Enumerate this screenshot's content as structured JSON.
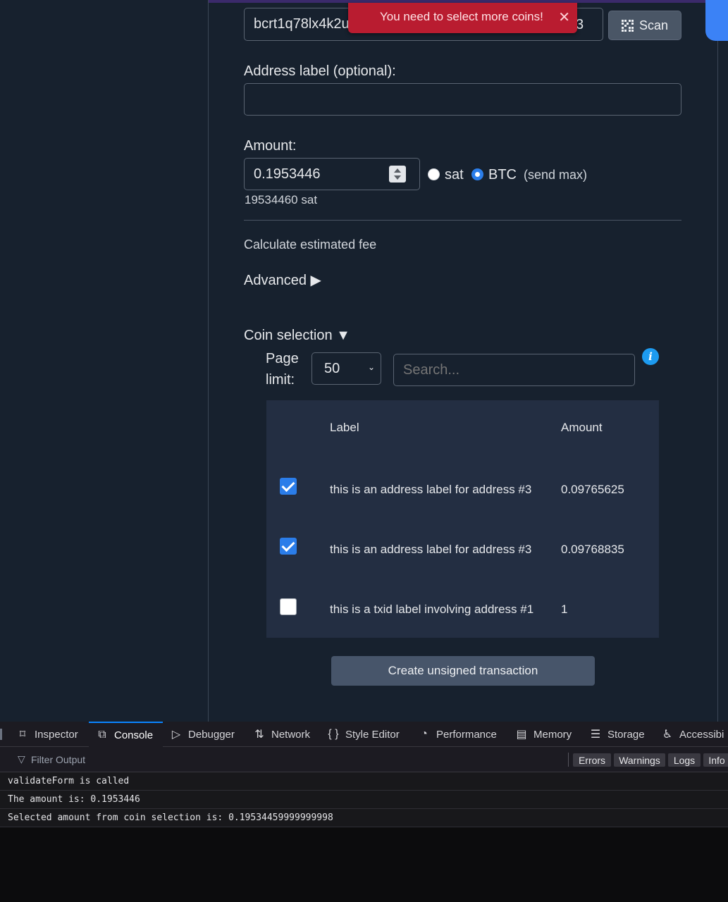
{
  "toast": {
    "message": "You need to select more coins!",
    "close": "✕"
  },
  "address": {
    "value": "bcrt1q78lx4k2u",
    "value_tail": "3"
  },
  "scan": {
    "label": "Scan"
  },
  "address_label": {
    "label": "Address label (optional):",
    "value": ""
  },
  "amount": {
    "label": "Amount:",
    "value": "0.1953446",
    "unit_sat": "sat",
    "unit_btc": "BTC",
    "selected_unit": "BTC",
    "send_max": "(send max)",
    "sat_equivalent": "19534460 sat"
  },
  "fee": {
    "label": "Calculate estimated fee"
  },
  "advanced": {
    "label": "Advanced ▶"
  },
  "coin_selection": {
    "label": "Coin selection ▼",
    "page_limit_label_1": "Page",
    "page_limit_label_2": "limit:",
    "page_limit_value": "50",
    "search_placeholder": "Search...",
    "columns": {
      "label": "Label",
      "amount": "Amount"
    },
    "rows": [
      {
        "checked": true,
        "label": "this is an address label for address #3",
        "amount": "0.09765625"
      },
      {
        "checked": true,
        "label": "this is an address label for address #3",
        "amount": "0.09768835"
      },
      {
        "checked": false,
        "label": "this is a txid label involving address #1",
        "amount": "1"
      }
    ]
  },
  "create_button": {
    "label": "Create unsigned transaction"
  },
  "devtools": {
    "tabs": [
      {
        "label": "Inspector",
        "icon": "⌑"
      },
      {
        "label": "Console",
        "icon": "⧉"
      },
      {
        "label": "Debugger",
        "icon": "▷"
      },
      {
        "label": "Network",
        "icon": "⇅"
      },
      {
        "label": "Style Editor",
        "icon": "{ }"
      },
      {
        "label": "Performance",
        "icon": "◔"
      },
      {
        "label": "Memory",
        "icon": "▤"
      },
      {
        "label": "Storage",
        "icon": "☰"
      },
      {
        "label": "Accessibi",
        "icon": "♿"
      }
    ],
    "active_tab": "Console",
    "filter_placeholder": "Filter Output",
    "levels": [
      "Errors",
      "Warnings",
      "Logs",
      "Info"
    ],
    "logs": [
      "validateForm is called",
      "The amount is: 0.1953446",
      "Selected amount from coin selection is: 0.19534459999999998"
    ]
  },
  "colors": {
    "accent": "#2b7de9",
    "toast": "#b91c30",
    "panel": "#17212e"
  }
}
